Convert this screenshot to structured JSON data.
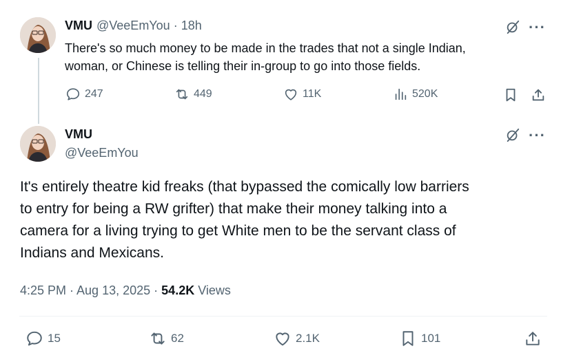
{
  "tweet1": {
    "name": "VMU",
    "handle": "@VeeEmYou",
    "separator": "·",
    "time": "18h",
    "text_line1": "There's so much money to be made in the trades that not a single Indian,",
    "text_line2": "woman, or Chinese is telling their in-group to go into those fields.",
    "replies": "247",
    "reposts": "449",
    "likes": "11K",
    "views": "520K",
    "icons": [
      "grok-icon",
      "more-icon",
      "reply-icon",
      "repost-icon",
      "like-icon",
      "views-icon",
      "bookmark-icon",
      "share-icon"
    ]
  },
  "tweet2": {
    "name": "VMU",
    "handle": "@VeeEmYou",
    "text_lines": [
      "It's entirely theatre kid freaks (that bypassed the comically low barriers",
      "to entry for being a RW grifter) that make their money talking into a",
      "camera for a living trying to get White men to be the servant class of",
      "Indians and Mexicans."
    ],
    "timestamp": "4:25 PM · Aug 13, 2025",
    "meta_sep": "·",
    "view_count": "54.2K",
    "views_label": "Views",
    "replies": "15",
    "reposts": "62",
    "likes": "2.1K",
    "bookmarks": "101"
  },
  "colors": {
    "text": "#0f1419",
    "secondary": "#536471",
    "divider": "#eff3f4",
    "thread_line": "#cfd9de"
  }
}
